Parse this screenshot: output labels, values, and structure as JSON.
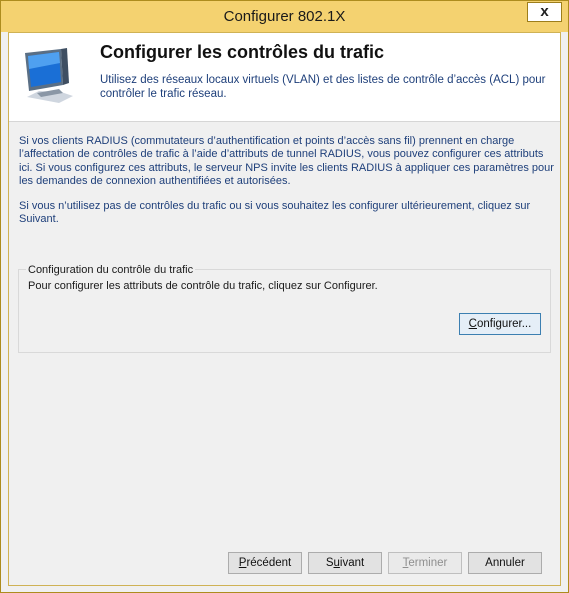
{
  "window": {
    "title": "Configurer 802.1X",
    "close_label": "x"
  },
  "header": {
    "title": "Configurer les contrôles du trafic",
    "description": "Utilisez des réseaux locaux virtuels (VLAN) et des listes de contrôle d’accès (ACL) pour contrôler le trafic réseau.",
    "icon": "network-monitor-icon"
  },
  "body": {
    "paragraph1": "Si vos clients RADIUS (commutateurs d’authentification et points d’accès sans fil) prennent en charge l’affectation de contrôles de trafic à l’aide d’attributs de tunnel RADIUS, vous pouvez configurer ces attributs ici. Si vous configurez ces attributs, le serveur NPS invite les clients RADIUS à appliquer ces paramètres pour les demandes de connexion authentifiées et autorisées.",
    "paragraph2": "Si vous n’utilisez pas de contrôles du trafic ou si vous souhaitez les configurer ultérieurement, cliquez sur Suivant."
  },
  "group": {
    "title": "Configuration du contrôle du trafic",
    "text": "Pour configurer les attributs de contrôle du trafic, cliquez sur Configurer.",
    "configure_button": {
      "mnemonic": "C",
      "rest": "onfigurer..."
    }
  },
  "footer": {
    "previous_button": {
      "mnemonic": "P",
      "rest": "récédent"
    },
    "next_button": {
      "pre": "S",
      "mnemonic": "u",
      "rest": "ivant"
    },
    "finish_button": {
      "mnemonic": "T",
      "rest": "erminer",
      "disabled": true
    },
    "cancel_button": {
      "label": "Annuler"
    }
  },
  "colors": {
    "titlebar": "#f4d270",
    "frame_border": "#cfb255",
    "text_blue": "#1e3f7a"
  }
}
